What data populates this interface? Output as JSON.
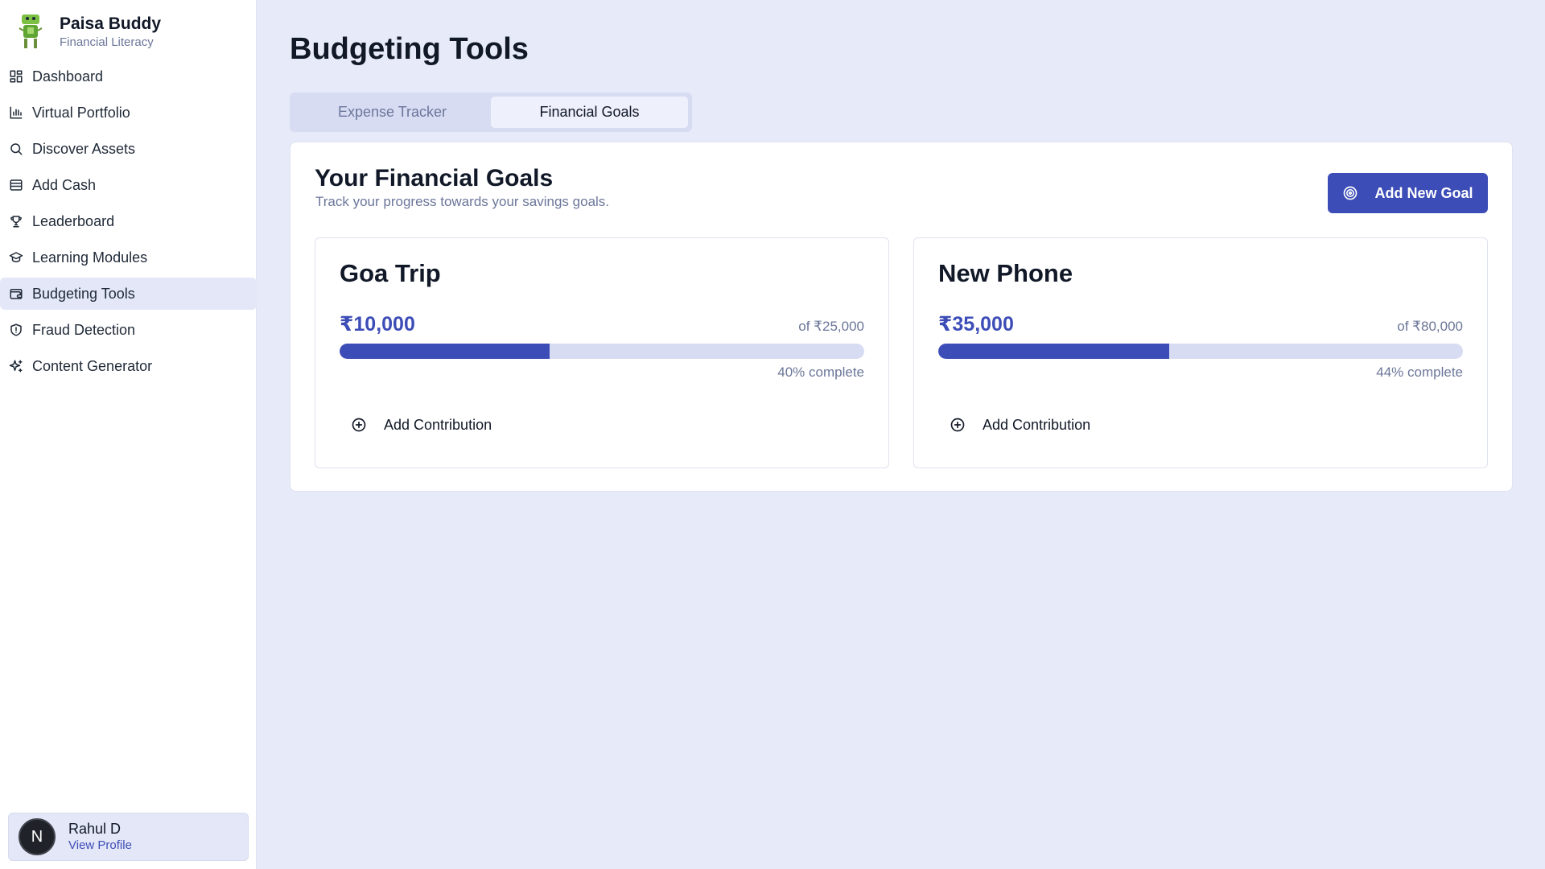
{
  "brand": {
    "title": "Paisa Buddy",
    "subtitle": "Financial Literacy"
  },
  "sidebar": {
    "items": [
      {
        "label": "Dashboard",
        "icon": "dashboard-icon"
      },
      {
        "label": "Virtual Portfolio",
        "icon": "chart-icon"
      },
      {
        "label": "Discover Assets",
        "icon": "search-icon"
      },
      {
        "label": "Add Cash",
        "icon": "wallet-icon"
      },
      {
        "label": "Leaderboard",
        "icon": "trophy-icon"
      },
      {
        "label": "Learning Modules",
        "icon": "graduation-cap-icon"
      },
      {
        "label": "Budgeting Tools",
        "icon": "wallet-card-icon",
        "active": true
      },
      {
        "label": "Fraud Detection",
        "icon": "shield-icon"
      },
      {
        "label": "Content Generator",
        "icon": "sparkles-icon"
      }
    ]
  },
  "profile": {
    "avatar_letter": "N",
    "name": "Rahul D",
    "link": "View Profile"
  },
  "page": {
    "title": "Budgeting Tools"
  },
  "tabs": [
    {
      "label": "Expense Tracker",
      "active": false
    },
    {
      "label": "Financial Goals",
      "active": true
    }
  ],
  "goals_section": {
    "title": "Your Financial Goals",
    "subtitle": "Track your progress towards your savings goals.",
    "add_button": "Add New Goal",
    "goals": [
      {
        "name": "Goa Trip",
        "saved": "₹10,000",
        "target": "of ₹25,000",
        "percent": 40,
        "percent_label": "40% complete",
        "contribute_label": "Add Contribution"
      },
      {
        "name": "New Phone",
        "saved": "₹35,000",
        "target": "of ₹80,000",
        "percent": 44,
        "percent_label": "44% complete",
        "contribute_label": "Add Contribution"
      }
    ]
  },
  "colors": {
    "accent": "#3d4db7",
    "background": "#e7eaf8",
    "track": "#d7dcf3"
  }
}
